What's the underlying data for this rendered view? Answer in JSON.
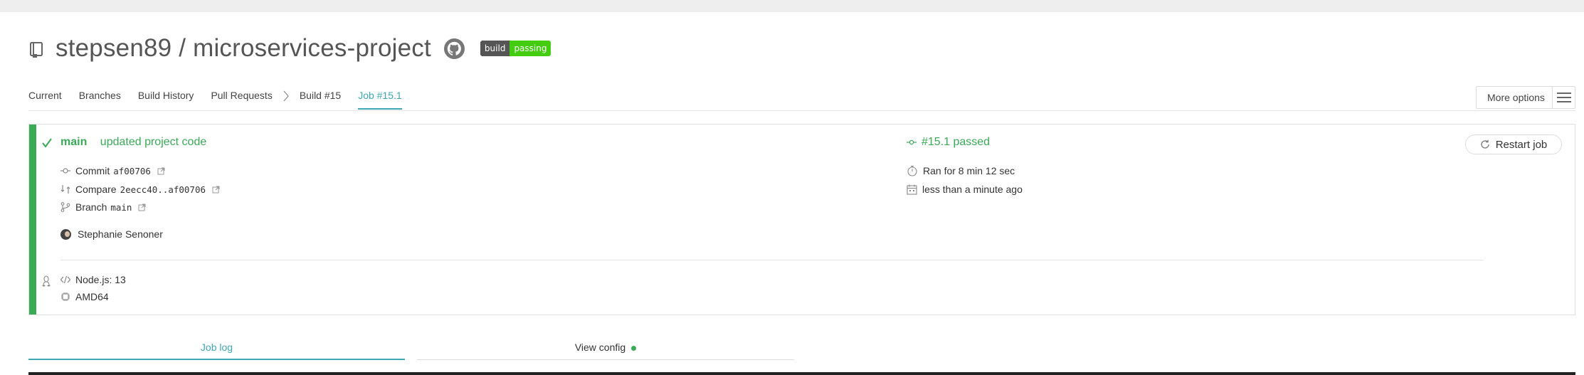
{
  "repo": {
    "title": "stepsen89 / microservices-project",
    "badge_left": "build",
    "badge_right": "passing"
  },
  "tabs": [
    {
      "label": "Current"
    },
    {
      "label": "Branches"
    },
    {
      "label": "Build History"
    },
    {
      "label": "Pull Requests"
    },
    {
      "label": "Build #15"
    },
    {
      "label": "Job #15.1"
    }
  ],
  "more_options": {
    "label": "More options"
  },
  "job": {
    "branch": "main",
    "message": "updated project code",
    "commit_label": "Commit",
    "commit_sha": "af00706",
    "compare_label": "Compare",
    "compare_range": "2eecc40..af00706",
    "branch_label": "Branch",
    "branch_name": "main",
    "author": "Stephanie Senoner",
    "status": "#15.1 passed",
    "duration": "Ran for 8 min 12 sec",
    "finished": "less than a minute ago",
    "restart_label": "Restart job",
    "language": "Node.js: 13",
    "arch": "AMD64"
  },
  "bottom_tabs": {
    "log": "Job log",
    "config": "View config"
  },
  "colors": {
    "passed": "#39aa56",
    "accent": "#3ea8b5",
    "badge_green": "#44cc11"
  }
}
